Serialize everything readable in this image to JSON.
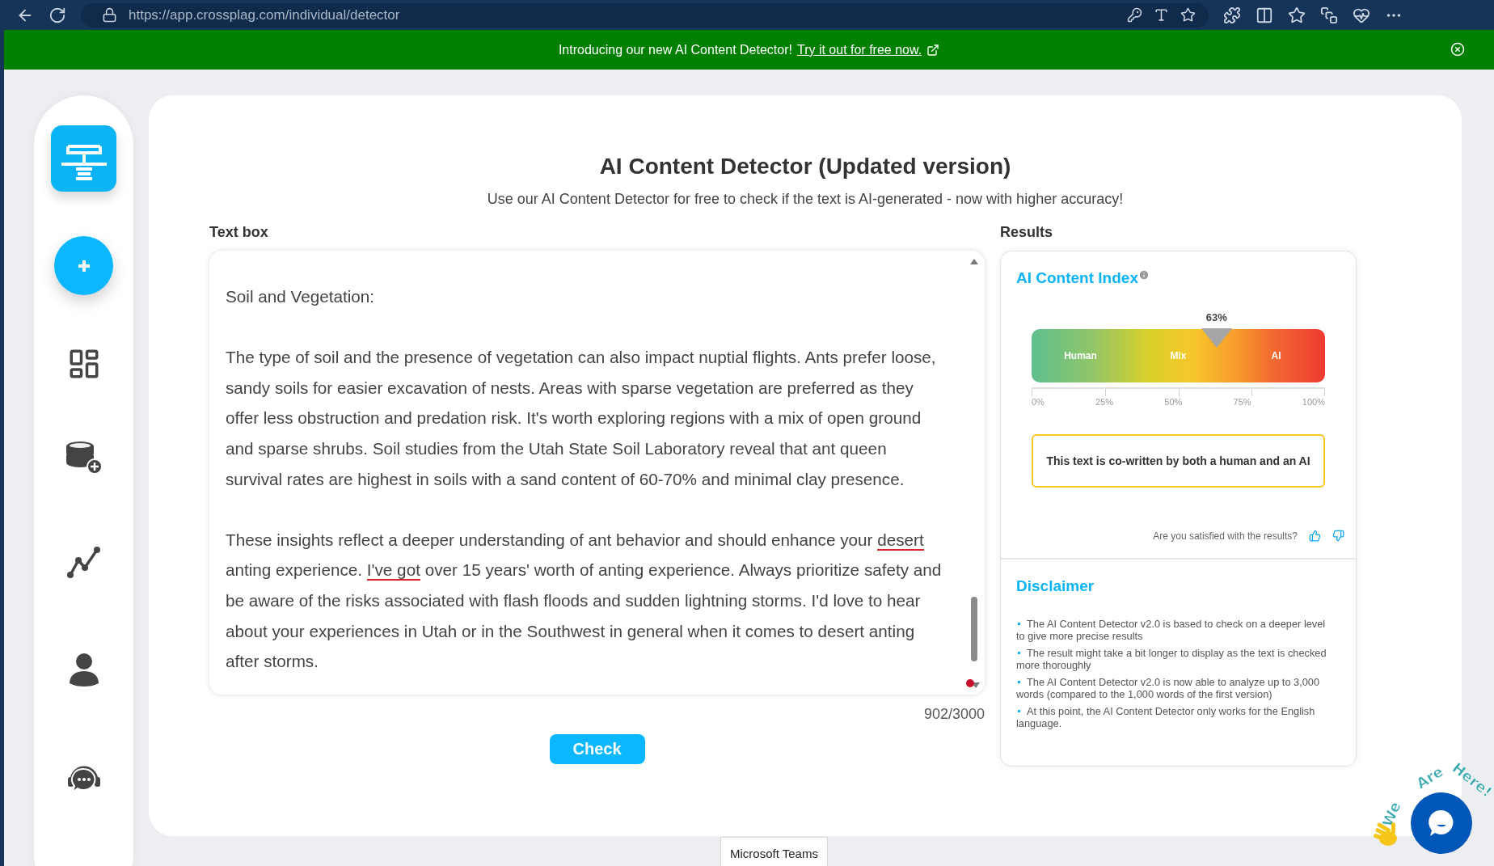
{
  "browser": {
    "url": "https://app.crossplag.com/individual/detector"
  },
  "banner": {
    "text": "Introducing our new AI Content Detector!",
    "link": "Try it out for free now."
  },
  "page": {
    "title": "AI Content Detector (Updated version)",
    "subtitle": "Use our AI Content Detector for free to check if the text is AI-generated - now with higher accuracy!"
  },
  "text_box": {
    "label": "Text box",
    "paragraphs": [
      [
        {
          "text": "Soil and Vegetation:",
          "flagged": false
        }
      ],
      [
        {
          "text": "The type of soil and the presence of vegetation can also impact nuptial flights. Ants prefer loose, sandy soils for easier excavation of nests. Areas with sparse vegetation are preferred as they offer less obstruction and predation risk. It's worth exploring regions with a mix of open ground and sparse shrubs. Soil studies from the Utah State Soil Laboratory reveal that ant queen survival rates are highest in soils with a sand content of 60-70% and minimal clay presence.",
          "flagged": false
        }
      ],
      [
        {
          "text": "These insights reflect a deeper understanding of ant behavior and should enhance your ",
          "flagged": false
        },
        {
          "text": "desert",
          "flagged": true
        },
        {
          "text": " anting experience. ",
          "flagged": false
        },
        {
          "text": "I've got",
          "flagged": true
        },
        {
          "text": " over 15 years' worth of anting experience. Always prioritize safety and be aware of the risks associated with flash floods and sudden lightning storms. I'd love to hear about your experiences in Utah or in the Southwest in general when it comes to desert anting after storms.",
          "flagged": false
        }
      ]
    ],
    "counter": "902/3000"
  },
  "check_button": "Check",
  "results": {
    "label": "Results",
    "index_title": "AI Content Index",
    "gauge": {
      "level": 0.63,
      "reading": "63%",
      "zones": [
        "Human",
        "Mix",
        "AI"
      ],
      "ticks": [
        "0%",
        "25%",
        "50%",
        "75%",
        "100%"
      ]
    },
    "verdict": "This text is co-written by both a human and an AI",
    "feedback": "Are you satisfied with the results?"
  },
  "disclaimer": {
    "title": "Disclaimer",
    "items": [
      "The AI Content Detector v2.0 is based to check on a deeper level to give more precise results",
      "The result might take a bit longer to display as the text is checked more thoroughly",
      "The AI Content Detector v2.0 is now able to analyze up to 3,000 words (compared to the 1,000 words of the first version)",
      "At this point, the AI Content Detector only works for the English language."
    ]
  },
  "tooltip": "Microsoft Teams",
  "chat_widget": {
    "caption": "We Are Here!"
  }
}
